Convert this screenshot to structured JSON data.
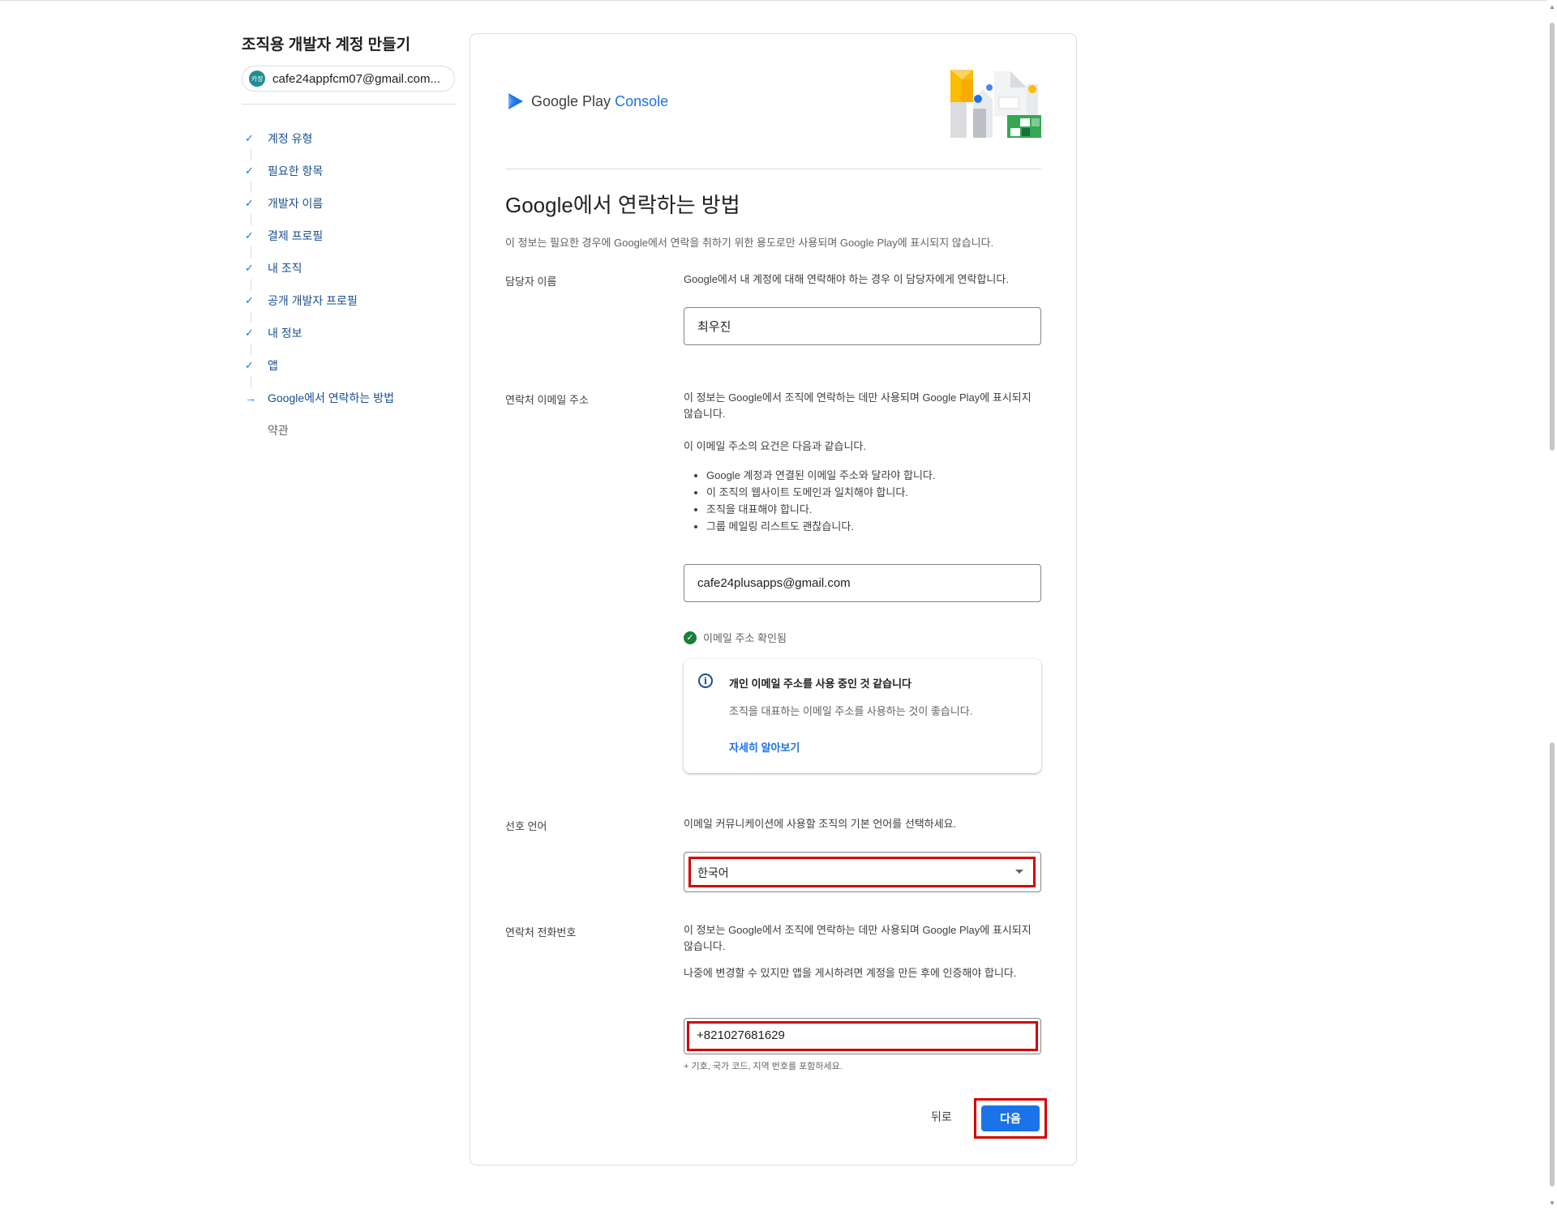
{
  "sidebar": {
    "title": "조직용 개발자 계정 만들기",
    "account": {
      "avatar_text": "카정",
      "email": "cafe24appfcm07@gmail.com..."
    },
    "steps": [
      {
        "label": "계정 유형",
        "status": "done"
      },
      {
        "label": "필요한 항목",
        "status": "done"
      },
      {
        "label": "개발자 이름",
        "status": "done"
      },
      {
        "label": "결제 프로필",
        "status": "done"
      },
      {
        "label": "내 조직",
        "status": "done"
      },
      {
        "label": "공개 개발자 프로필",
        "status": "done"
      },
      {
        "label": "내 정보",
        "status": "done"
      },
      {
        "label": "앱",
        "status": "done"
      },
      {
        "label": "Google에서 연락하는 방법",
        "status": "current"
      },
      {
        "label": "약관",
        "status": "pending"
      }
    ]
  },
  "header": {
    "logo_google_play": "Google Play",
    "logo_console": "Console"
  },
  "page": {
    "title": "Google에서 연락하는 방법",
    "description": "이 정보는 필요한 경우에 Google에서 연락을 취하기 위한 용도로만 사용되며 Google Play에 표시되지 않습니다."
  },
  "contact_name": {
    "label": "담당자 이름",
    "help": "Google에서 내 계정에 대해 연락해야 하는 경우 이 담당자에게 연락합니다.",
    "value": "최우진"
  },
  "contact_email": {
    "label": "연락처 이메일 주소",
    "help": "이 정보는 Google에서 조직에 연락하는 데만 사용되며 Google Play에 표시되지 않습니다.",
    "requirements_intro": "이 이메일 주소의 요건은 다음과 같습니다.",
    "requirements": [
      "Google 계정과 연결된 이메일 주소와 달라야 합니다.",
      "이 조직의 웹사이트 도메인과 일치해야 합니다.",
      "조직을 대표해야 합니다.",
      "그룹 메일링 리스트도 괜찮습니다."
    ],
    "value": "cafe24plusapps@gmail.com",
    "verified_text": "이메일 주소 확인됨",
    "notice": {
      "title": "개인 이메일 주소를 사용 중인 것 같습니다",
      "body": "조직을 대표하는 이메일 주소를 사용하는 것이 좋습니다.",
      "link": "자세히 알아보기"
    }
  },
  "language": {
    "label": "선호 언어",
    "help": "이메일 커뮤니케이션에 사용할 조직의 기본 언어를 선택하세요.",
    "selected": "한국어"
  },
  "phone": {
    "label": "연락처 전화번호",
    "help1": "이 정보는 Google에서 조직에 연락하는 데만 사용되며 Google Play에 표시되지 않습니다.",
    "help2": "나중에 변경할 수 있지만 앱을 게시하려면 계정을 만든 후에 인증해야 합니다.",
    "value": "+821027681629",
    "hint": "+ 기호, 국가 코드, 지역 번호를 포함하세요."
  },
  "footer": {
    "back_label": "뒤로",
    "next_label": "다음"
  },
  "colors": {
    "primary": "#1a73e8",
    "highlight": "#d50000",
    "success": "#188038"
  }
}
